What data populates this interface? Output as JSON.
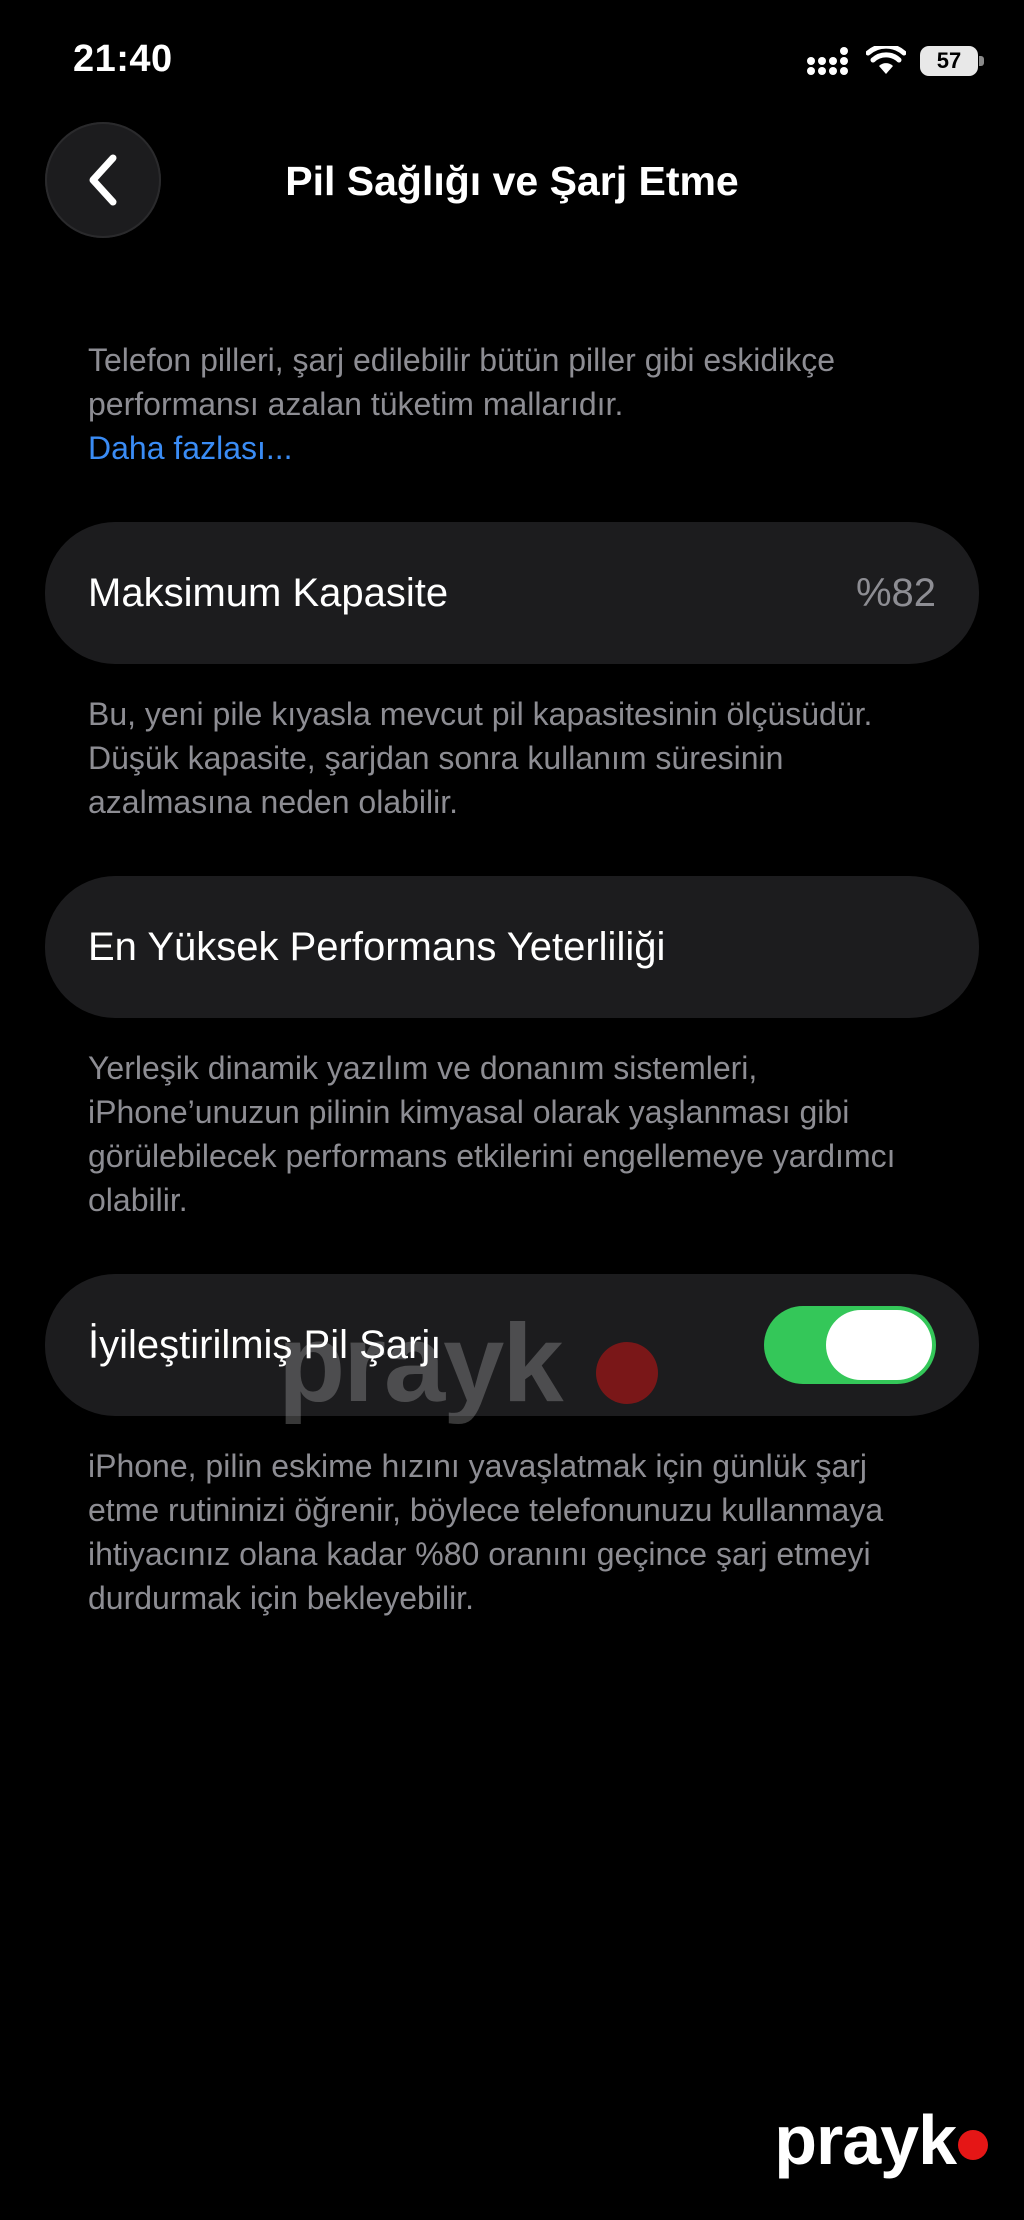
{
  "status_bar": {
    "time": "21:40",
    "battery_level": "57"
  },
  "nav": {
    "title": "Pil Sağlığı ve Şarj Etme"
  },
  "intro": {
    "text": "Telefon pilleri, şarj edilebilir bütün piller gibi eskidikçe performansı azalan tüketim mallarıdır.",
    "link": "Daha fazlası..."
  },
  "max_capacity": {
    "label": "Maksimum Kapasite",
    "value": "%82",
    "footer": "Bu, yeni pile kıyasla mevcut pil kapasitesinin ölçüsüdür. Düşük kapasite, şarjdan sonra kullanım süresinin azalmasına neden olabilir."
  },
  "peak_performance": {
    "label": "En Yüksek Performans Yeterliliği",
    "footer": "Yerleşik dinamik yazılım ve donanım sistemleri, iPhone’unuzun pilinin kimyasal olarak yaşlanması gibi görülebilecek performans etkilerini engellemeye yardımcı olabilir."
  },
  "optimized_charging": {
    "label": "İyileştirilmiş Pil Şarjı",
    "enabled": true,
    "footer": "iPhone, pilin eskime hızını yavaşlatmak için günlük şarj etme rutininizi öğrenir, böylece telefonunuzu kullanmaya ihtiyacınız olana kadar %80 oranını geçince şarj etmeyi durdurmak için bekleyebilir."
  },
  "watermark": {
    "text": "prayk"
  },
  "colors": {
    "toggle_on": "#34c759",
    "link": "#3a8cf5",
    "card_bg": "#1c1c1e",
    "brand_dot": "#e51616"
  }
}
